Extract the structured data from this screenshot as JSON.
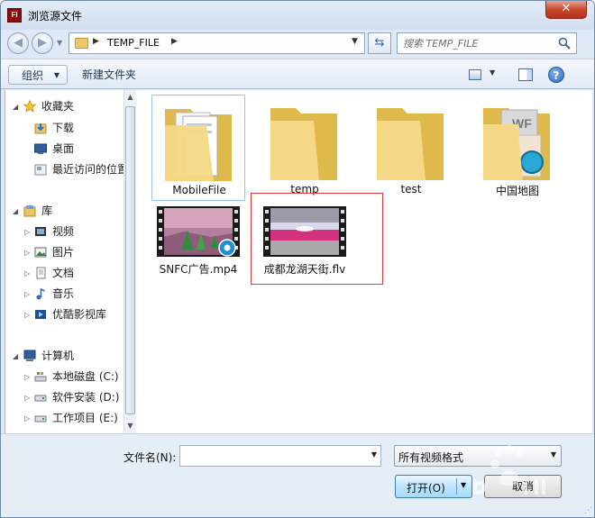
{
  "window": {
    "title": "浏览源文件",
    "app_icon_text": "Fl",
    "close_label": "✕"
  },
  "address_bar": {
    "path": "TEMP_FILE",
    "search_placeholder": "搜索 TEMP_FILE"
  },
  "toolbar": {
    "organize_label": "组织",
    "new_folder_label": "新建文件夹"
  },
  "sidebar": {
    "favorites": {
      "label": "收藏夹",
      "items": [
        "下载",
        "桌面",
        "最近访问的位置"
      ]
    },
    "libraries": {
      "label": "库",
      "items": [
        "视频",
        "图片",
        "文档",
        "音乐",
        "优酷影视库"
      ]
    },
    "computer": {
      "label": "计算机",
      "items": [
        "本地磁盘 (C:)",
        "软件安装 (D:)",
        "工作项目 (E:)"
      ]
    }
  },
  "files": [
    {
      "name": "MobileFile",
      "type": "folder",
      "selected": true
    },
    {
      "name": "temp",
      "type": "folder"
    },
    {
      "name": "test",
      "type": "folder"
    },
    {
      "name": "中国地图",
      "type": "folder"
    },
    {
      "name": "SNFC广告.mp4",
      "type": "video"
    },
    {
      "name": "成都龙湖天街.flv",
      "type": "video",
      "highlighted": true
    }
  ],
  "bottom": {
    "filename_label": "文件名(N):",
    "filename_value": "",
    "filter_value": "所有视频格式",
    "open_label": "打开(O)",
    "cancel_label": "取消"
  },
  "colors": {
    "highlight_border": "#d93a3a",
    "folder_yellow": "#f2d27a",
    "selection_border": "#99c2ea"
  }
}
